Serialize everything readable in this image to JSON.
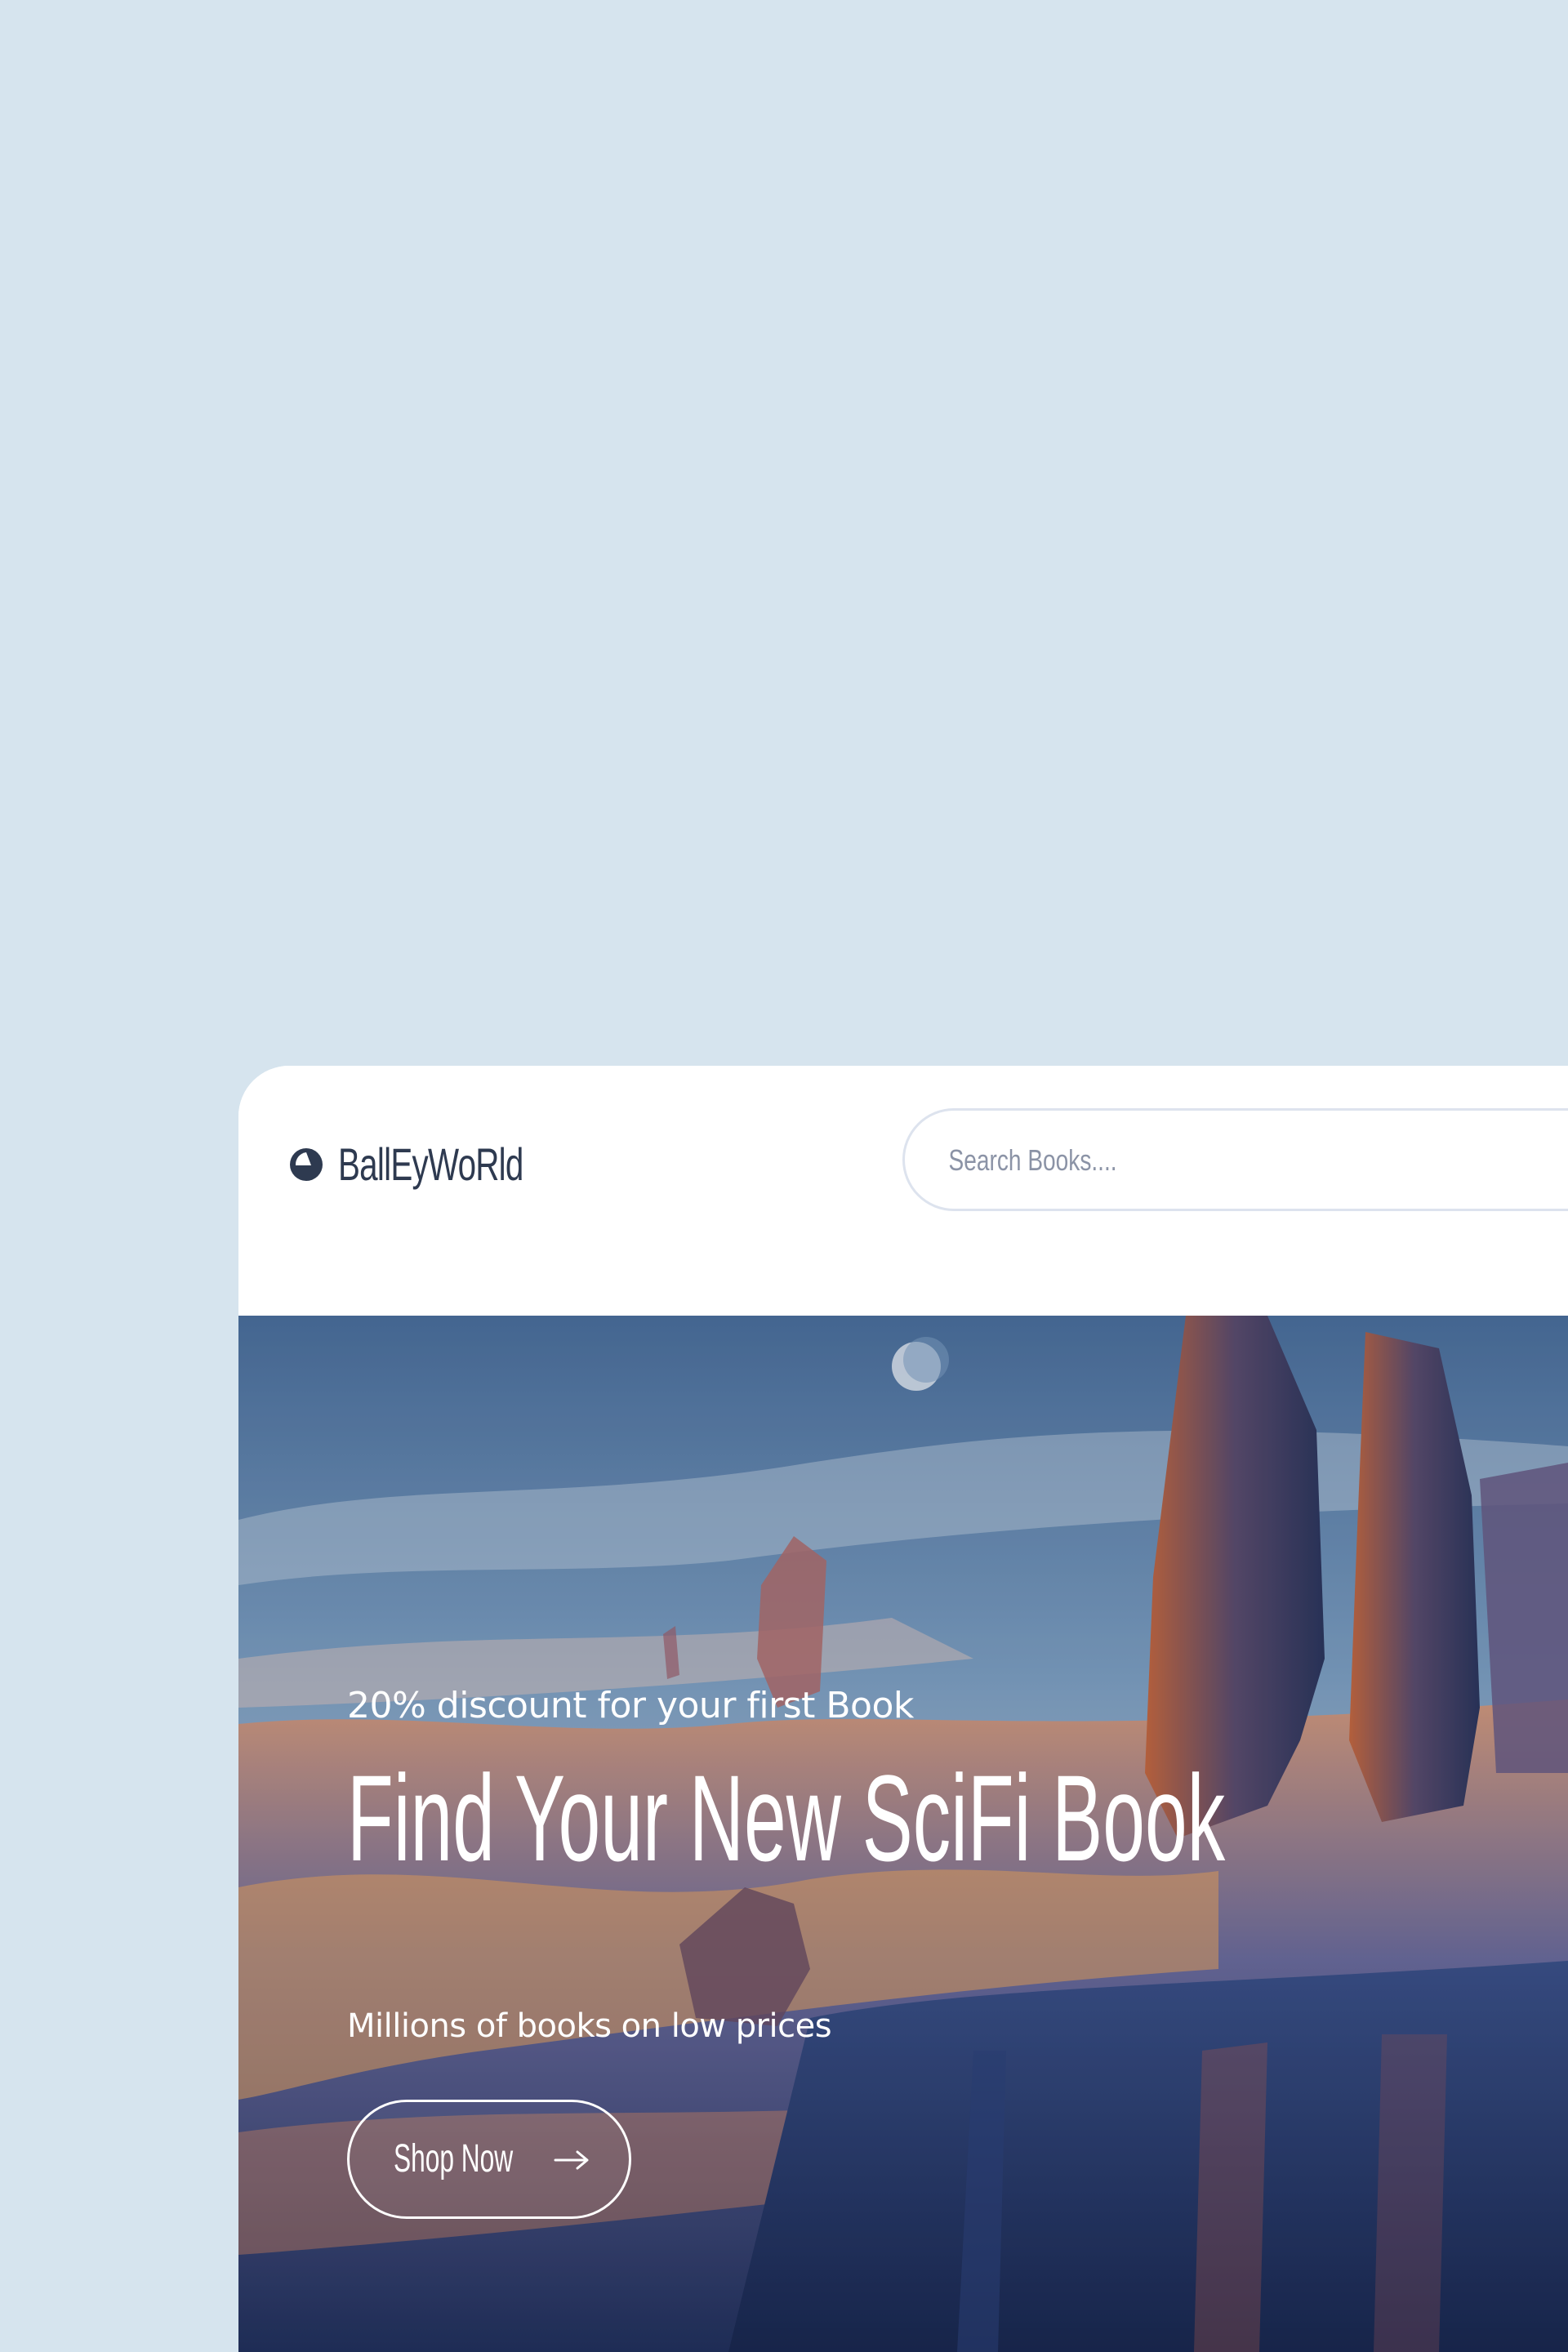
{
  "brand": {
    "name": "BallEyWoRld",
    "logo_icon": "half-moon-circle-icon"
  },
  "search": {
    "placeholder": "Search Books...."
  },
  "hero": {
    "promo": "20% discount for your first Book",
    "title": "Find Your New SciFi Book",
    "subtitle": "Millions of books on low prices",
    "cta_label": "Shop Now",
    "cta_icon": "arrow-right-icon"
  },
  "colors": {
    "page_background": "#d6e4ee",
    "card_background": "#ffffff",
    "brand_text": "#2e3a50",
    "hero_text": "#ffffff"
  }
}
